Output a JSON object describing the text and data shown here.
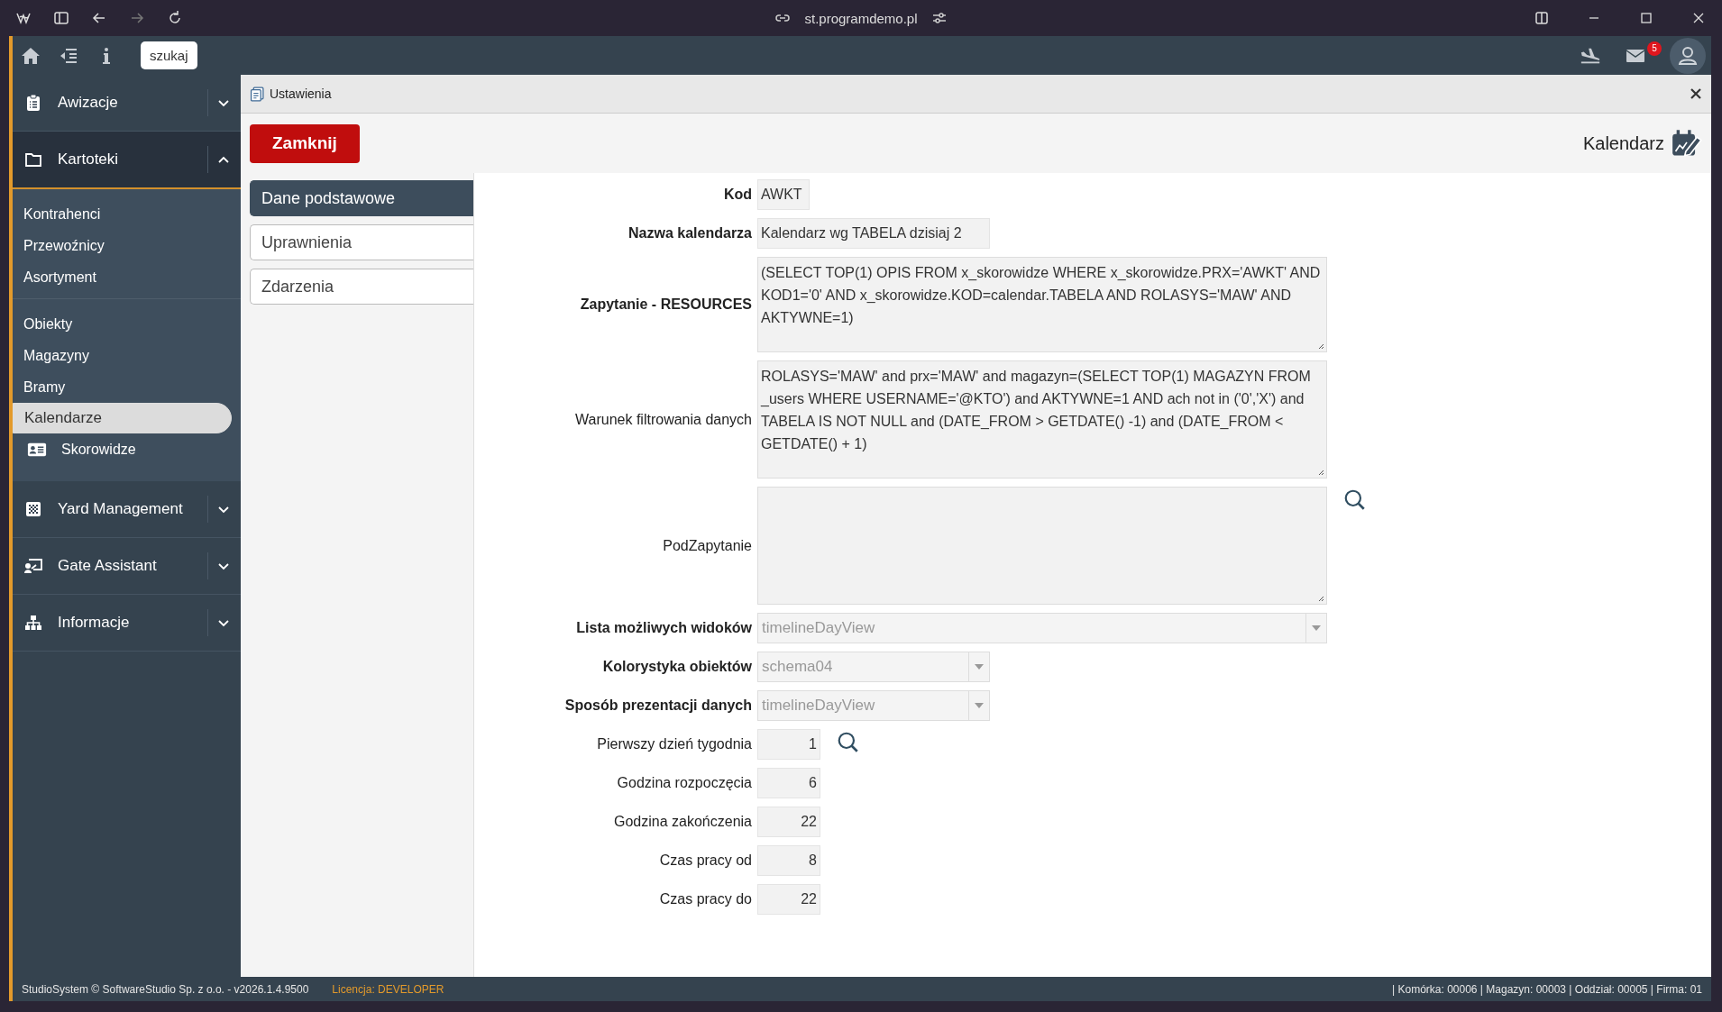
{
  "browser": {
    "url": "st.programdemo.pl"
  },
  "topbar": {
    "search_button": "szukaj",
    "mail_badge": "5"
  },
  "sidebar": {
    "groups": [
      {
        "label": "Awizacje",
        "expanded": false
      },
      {
        "label": "Kartoteki",
        "expanded": true,
        "sections": [
          {
            "items": [
              {
                "kind": "link",
                "label": "Kontrahenci",
                "selected": false
              },
              {
                "kind": "link",
                "label": "Przewoźnicy",
                "selected": false
              },
              {
                "kind": "link",
                "label": "Asortyment",
                "selected": false
              }
            ]
          },
          {
            "items": [
              {
                "kind": "link",
                "label": "Obiekty",
                "selected": false
              },
              {
                "kind": "link",
                "label": "Magazyny",
                "selected": false
              },
              {
                "kind": "link",
                "label": "Bramy",
                "selected": false
              },
              {
                "kind": "link",
                "label": "Kalendarze",
                "selected": true
              },
              {
                "kind": "module",
                "label": "Skorowidze",
                "selected": false
              }
            ]
          }
        ]
      },
      {
        "label": "Yard Management",
        "expanded": false
      },
      {
        "label": "Gate Assistant",
        "expanded": false
      },
      {
        "label": "Informacje",
        "expanded": false
      }
    ]
  },
  "panel": {
    "title": "Ustawienia",
    "close_button": "Zamknij",
    "record_type": "Kalendarz"
  },
  "tabs": [
    {
      "label": "Dane podstawowe",
      "selected": true
    },
    {
      "label": "Uprawnienia",
      "selected": false
    },
    {
      "label": "Zdarzenia",
      "selected": false
    }
  ],
  "fields": [
    {
      "kind": "input",
      "label": "Kod",
      "bold": true,
      "value": "AWKT",
      "lookup": false
    },
    {
      "kind": "input",
      "label": "Nazwa kalendarza",
      "bold": true,
      "value": "Kalendarz wg TABELA dzisiaj 2",
      "lookup": false
    },
    {
      "kind": "textarea",
      "label": "Zapytanie - RESOURCES",
      "bold": true,
      "value": "(SELECT TOP(1) OPIS FROM x_skorowidze WHERE x_skorowidze.PRX='AWKT' AND KOD1='0' AND x_skorowidze.KOD=calendar.TABELA AND ROLASYS='MAW' AND AKTYWNE=1)",
      "lookup": false
    },
    {
      "kind": "textarea",
      "label": "Warunek filtrowania danych",
      "bold": false,
      "value": "ROLASYS='MAW' and prx='MAW' and magazyn=(SELECT TOP(1) MAGAZYN FROM _users WHERE USERNAME='@KTO') and AKTYWNE=1 AND ach not in ('0','X')  and TABELA IS NOT NULL and (DATE_FROM > GETDATE() -1) and (DATE_FROM < GETDATE() + 1)",
      "lookup": false
    },
    {
      "kind": "textarea",
      "label": "PodZapytanie",
      "bold": false,
      "lookup": true
    },
    {
      "kind": "select",
      "label": "Lista możliwych widoków",
      "bold": true,
      "value": "timelineDayView",
      "lookup": false
    },
    {
      "kind": "select",
      "label": "Kolorystyka obiektów",
      "bold": true,
      "value": "schema04",
      "lookup": false
    },
    {
      "kind": "select",
      "label": "Sposób prezentacji danych",
      "bold": true,
      "value": "timelineDayView",
      "lookup": false
    },
    {
      "kind": "number",
      "label": "Pierwszy dzień tygodnia",
      "bold": false,
      "value": "1",
      "lookup": true
    },
    {
      "kind": "number",
      "label": "Godzina rozpoczęcia",
      "bold": false,
      "value": "6",
      "lookup": false
    },
    {
      "kind": "number",
      "label": "Godzina zakończenia",
      "bold": false,
      "value": "22",
      "lookup": false
    },
    {
      "kind": "number",
      "label": "Czas pracy od",
      "bold": false,
      "value": "8",
      "lookup": false
    },
    {
      "kind": "number",
      "label": "Czas pracy do",
      "bold": false,
      "value": "22",
      "lookup": false
    }
  ],
  "status_bar": {
    "left": "StudioSystem © SoftwareStudio Sp. z o.o. - v2026.1.4.9500",
    "license_label": "Licencja:",
    "license_value": "DEVELOPER",
    "right": "| Komórka: 00006 | Magazyn: 00003 | Oddział: 00005 | Firma: 01"
  }
}
